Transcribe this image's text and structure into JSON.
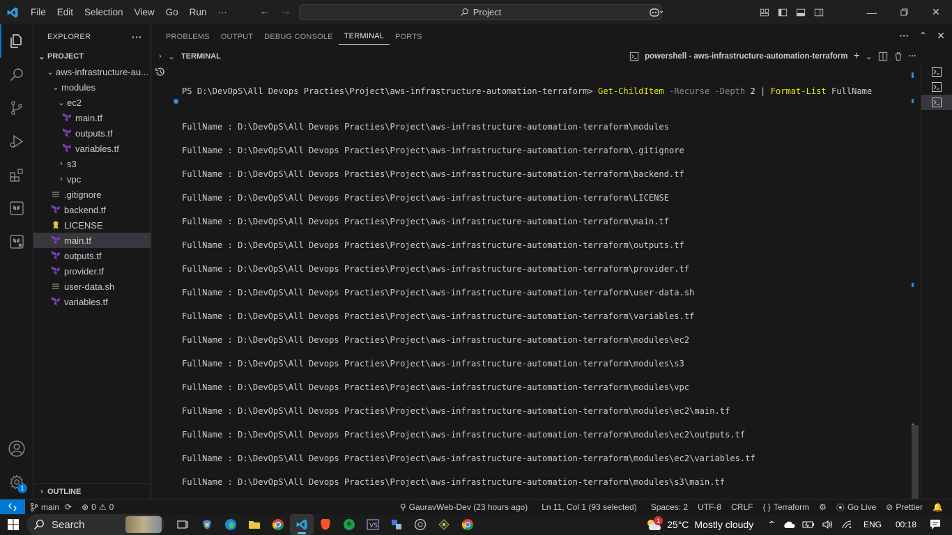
{
  "menu": [
    "File",
    "Edit",
    "Selection",
    "View",
    "Go",
    "Run",
    "···"
  ],
  "search": {
    "label": "Project"
  },
  "explorer": {
    "title": "EXPLORER",
    "more": "···",
    "section": "PROJECT",
    "tree": [
      {
        "label": "aws-infrastructure-au...",
        "indent": 1,
        "type": "folder-open"
      },
      {
        "label": "modules",
        "indent": 2,
        "type": "folder-open"
      },
      {
        "label": "ec2",
        "indent": 3,
        "type": "folder-open"
      },
      {
        "label": "main.tf",
        "indent": 4,
        "type": "tf"
      },
      {
        "label": "outputs.tf",
        "indent": 4,
        "type": "tf"
      },
      {
        "label": "variables.tf",
        "indent": 4,
        "type": "tf"
      },
      {
        "label": "s3",
        "indent": 3,
        "type": "folder-closed"
      },
      {
        "label": "vpc",
        "indent": 3,
        "type": "folder-closed"
      },
      {
        "label": ".gitignore",
        "indent": 2,
        "type": "lines"
      },
      {
        "label": "backend.tf",
        "indent": 2,
        "type": "tf"
      },
      {
        "label": "LICENSE",
        "indent": 2,
        "type": "license"
      },
      {
        "label": "main.tf",
        "indent": 2,
        "type": "tf",
        "selected": true
      },
      {
        "label": "outputs.tf",
        "indent": 2,
        "type": "tf"
      },
      {
        "label": "provider.tf",
        "indent": 2,
        "type": "tf"
      },
      {
        "label": "user-data.sh",
        "indent": 2,
        "type": "lines"
      },
      {
        "label": "variables.tf",
        "indent": 2,
        "type": "tf"
      }
    ],
    "outline": "OUTLINE"
  },
  "panel": {
    "tabs": [
      "PROBLEMS",
      "OUTPUT",
      "DEBUG CONSOLE",
      "TERMINAL",
      "PORTS"
    ],
    "active_tab": "TERMINAL",
    "terminal_label": "TERMINAL",
    "shell_label": "powershell - aws-infrastructure-automation-terraform"
  },
  "terminal": {
    "prompt": "PS D:\\DevOpS\\All Devops Practies\\Project\\aws-infrastructure-automation-terraform> ",
    "cmd1": "Get-ChildItem",
    "arg1": " -Recurse -Depth ",
    "num": "2",
    "pipe": " | ",
    "cmd2": "Format-List",
    "arg2": " FullName",
    "lines": [
      "FullName : D:\\DevOpS\\All Devops Practies\\Project\\aws-infrastructure-automation-terraform\\modules",
      "FullName : D:\\DevOpS\\All Devops Practies\\Project\\aws-infrastructure-automation-terraform\\.gitignore",
      "FullName : D:\\DevOpS\\All Devops Practies\\Project\\aws-infrastructure-automation-terraform\\backend.tf",
      "FullName : D:\\DevOpS\\All Devops Practies\\Project\\aws-infrastructure-automation-terraform\\LICENSE",
      "FullName : D:\\DevOpS\\All Devops Practies\\Project\\aws-infrastructure-automation-terraform\\main.tf",
      "FullName : D:\\DevOpS\\All Devops Practies\\Project\\aws-infrastructure-automation-terraform\\outputs.tf",
      "FullName : D:\\DevOpS\\All Devops Practies\\Project\\aws-infrastructure-automation-terraform\\provider.tf",
      "FullName : D:\\DevOpS\\All Devops Practies\\Project\\aws-infrastructure-automation-terraform\\user-data.sh",
      "FullName : D:\\DevOpS\\All Devops Practies\\Project\\aws-infrastructure-automation-terraform\\variables.tf",
      "FullName : D:\\DevOpS\\All Devops Practies\\Project\\aws-infrastructure-automation-terraform\\modules\\ec2",
      "FullName : D:\\DevOpS\\All Devops Practies\\Project\\aws-infrastructure-automation-terraform\\modules\\s3",
      "FullName : D:\\DevOpS\\All Devops Practies\\Project\\aws-infrastructure-automation-terraform\\modules\\vpc",
      "FullName : D:\\DevOpS\\All Devops Practies\\Project\\aws-infrastructure-automation-terraform\\modules\\ec2\\main.tf",
      "FullName : D:\\DevOpS\\All Devops Practies\\Project\\aws-infrastructure-automation-terraform\\modules\\ec2\\outputs.tf",
      "FullName : D:\\DevOpS\\All Devops Practies\\Project\\aws-infrastructure-automation-terraform\\modules\\ec2\\variables.tf",
      "FullName : D:\\DevOpS\\All Devops Practies\\Project\\aws-infrastructure-automation-terraform\\modules\\s3\\main.tf"
    ]
  },
  "statusbar": {
    "branch": "main",
    "errors": "0",
    "warnings": "0",
    "blame": "GauravWeb-Dev (23 hours ago)",
    "position": "Ln 11, Col 1 (93 selected)",
    "spaces": "Spaces: 2",
    "encoding": "UTF-8",
    "eol": "CRLF",
    "language": "Terraform",
    "golive": "Go Live",
    "prettier": "Prettier"
  },
  "activity_badge": "1",
  "taskbar": {
    "search": "Search",
    "weather_badge": "1",
    "temp": "25°C",
    "weather": "Mostly cloudy",
    "lang": "ENG",
    "time": "00:18"
  },
  "colors": {
    "accent": "#0078d4",
    "terraform": "#7b42bc",
    "command": "#e5e510"
  }
}
